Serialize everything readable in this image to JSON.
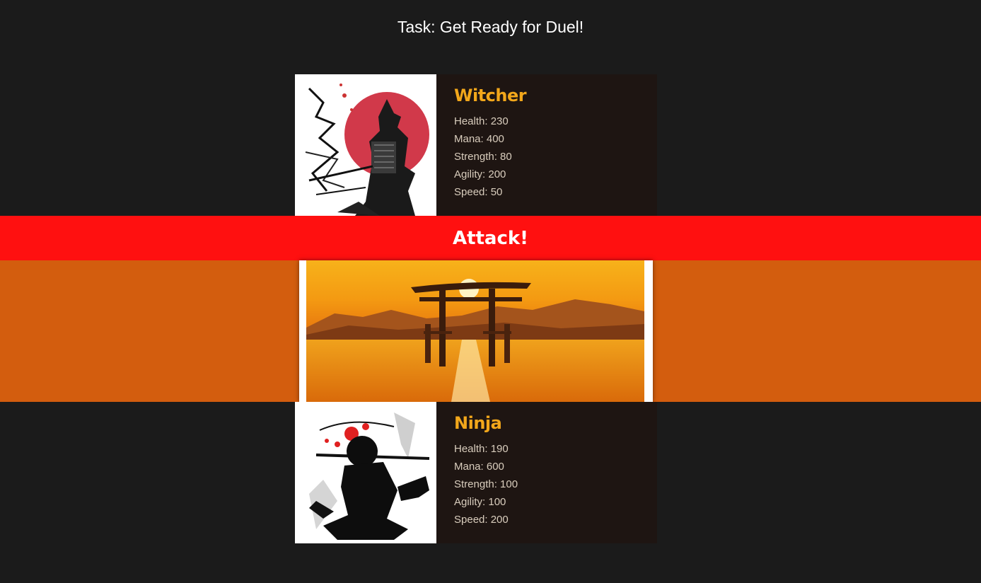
{
  "task": {
    "title": "Task: Get Ready for Duel!"
  },
  "players": [
    {
      "name": "Witcher",
      "stats": {
        "health": "Health: 230",
        "mana": "Mana: 400",
        "strength": "Strength: 80",
        "agility": "Agility: 200",
        "speed": "Speed: 50"
      }
    },
    {
      "name": "Ninja",
      "stats": {
        "health": "Health: 190",
        "mana": "Mana: 600",
        "strength": "Strength: 100",
        "agility": "Agility: 100",
        "speed": "Speed: 200"
      }
    }
  ],
  "attack": {
    "label": "Attack!"
  },
  "colors": {
    "background": "#1b1b1b",
    "card": "#1e1512",
    "name": "#f2a71b",
    "banner": "#ff1010",
    "arena": "#d35d0e"
  },
  "images": {
    "player1": "samurai-with-red-sun-illustration",
    "player2": "ninja-ink-silhouette-illustration",
    "arena": "torii-gate-sunset-painting"
  }
}
